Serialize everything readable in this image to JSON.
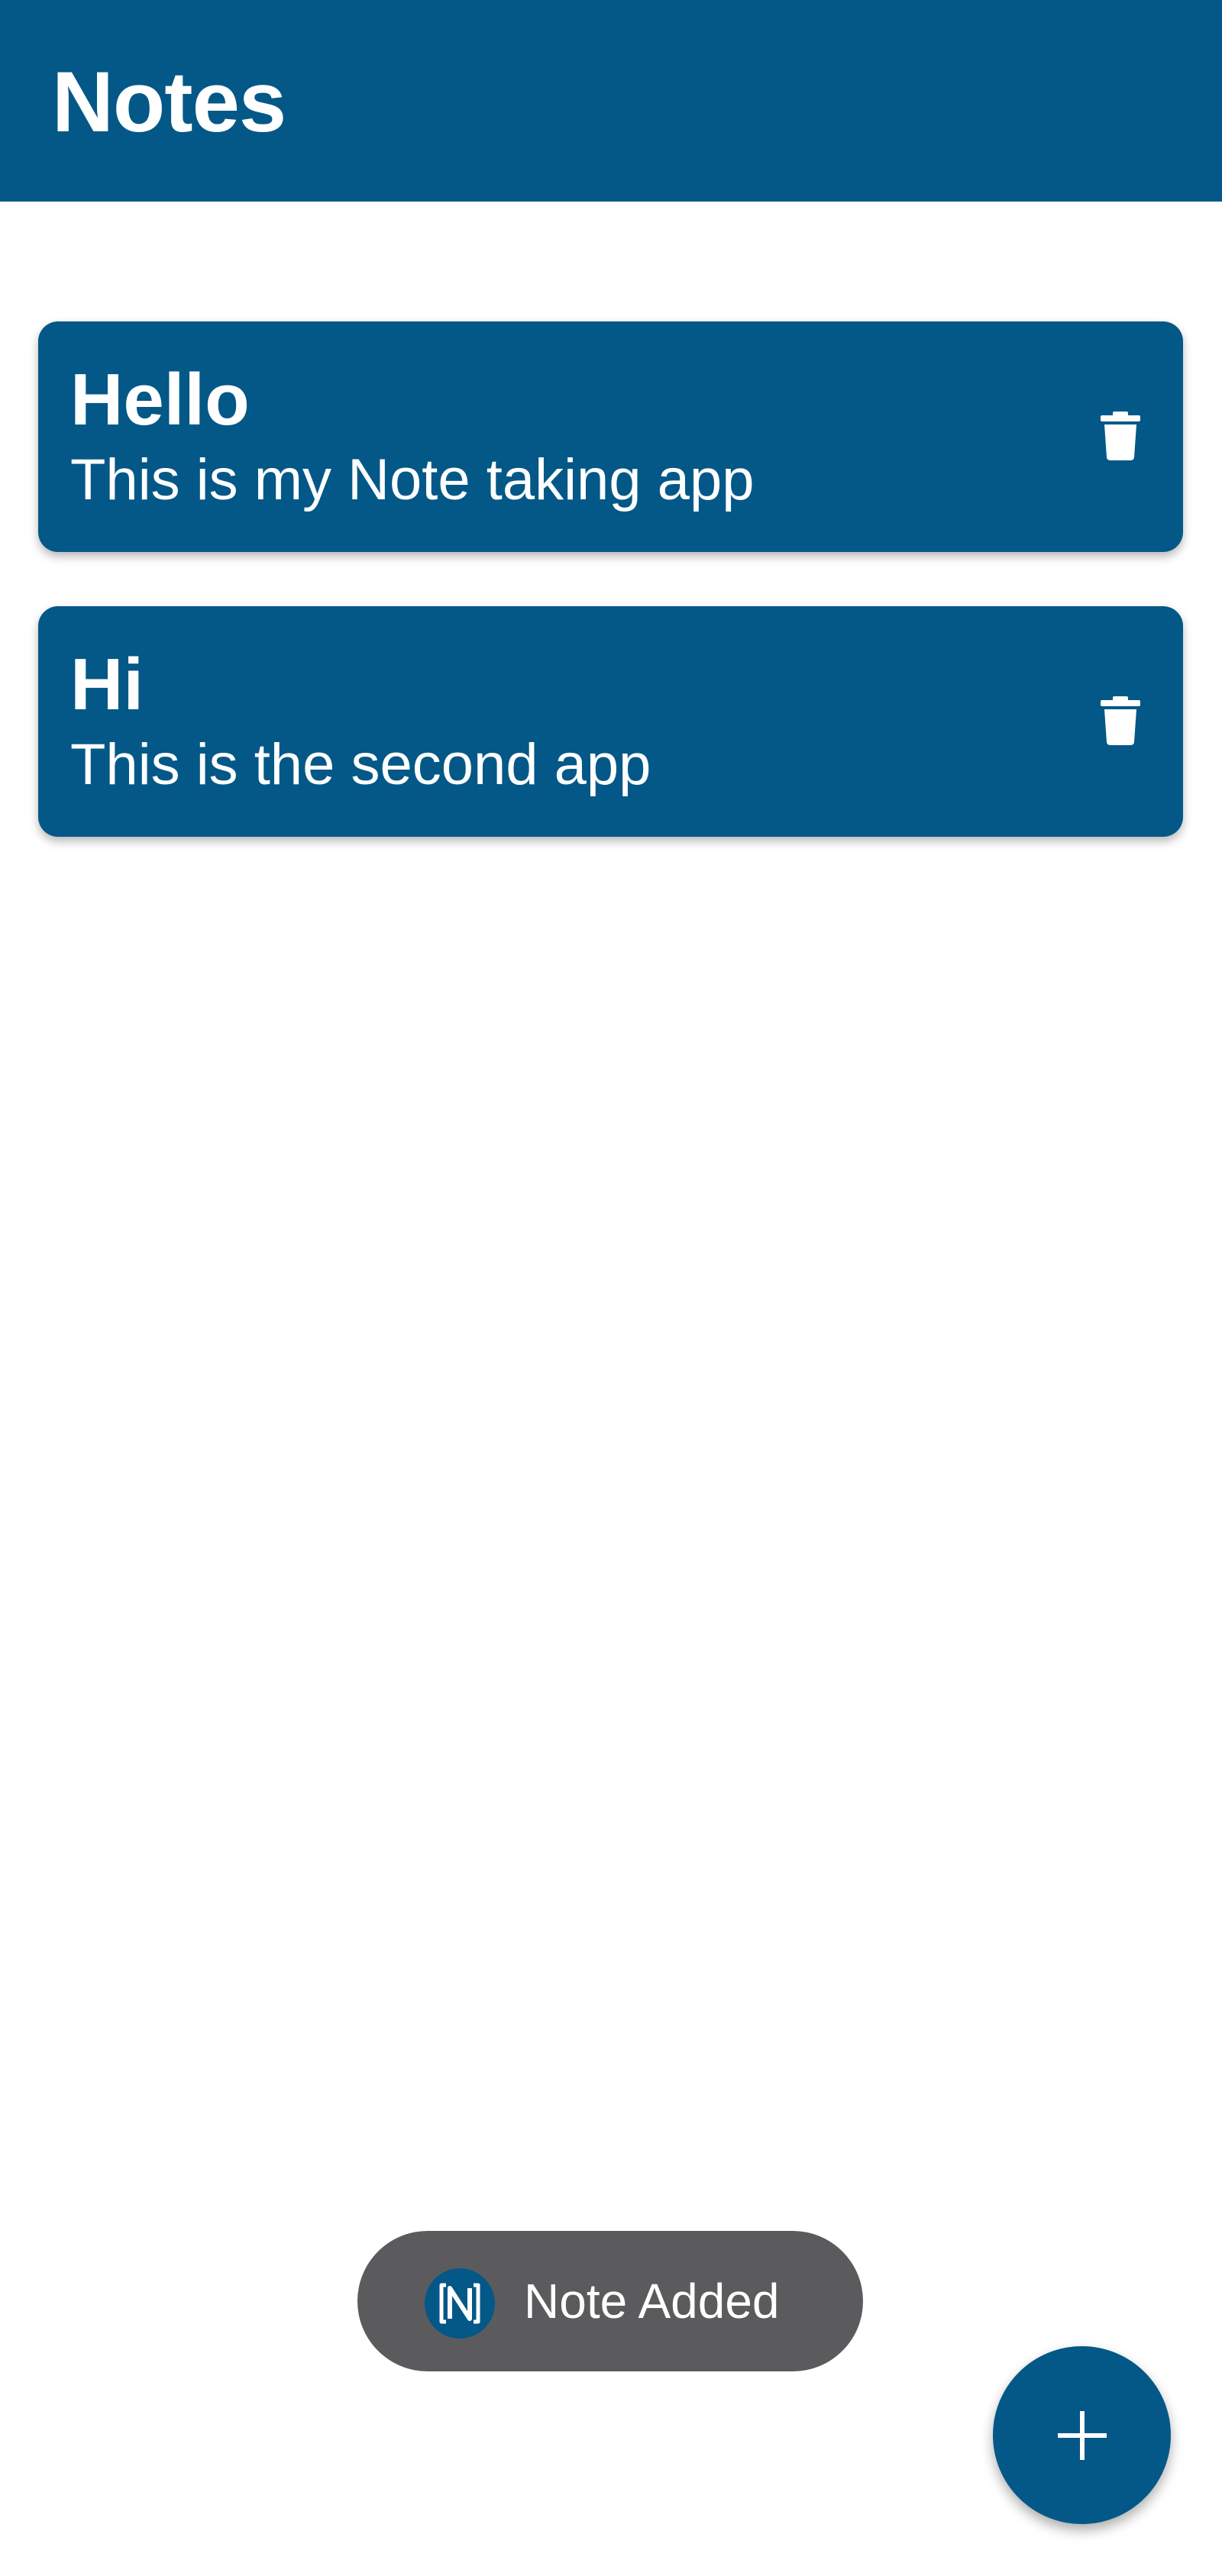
{
  "app": {
    "title": "Notes"
  },
  "notes": [
    {
      "title": "Hello",
      "body": "This is my Note taking app",
      "action_icon": "trash-icon"
    },
    {
      "title": "Hi",
      "body": "This is the second app",
      "action_icon": "trash-icon"
    }
  ],
  "toast": {
    "app_icon": "notes-app-icon",
    "message": "Note Added"
  },
  "fab": {
    "icon": "plus-icon"
  },
  "colors": {
    "primary": "#035887",
    "background": "#ffffff",
    "toast_background": "#5b5b5d",
    "on_primary": "#ffffff"
  }
}
